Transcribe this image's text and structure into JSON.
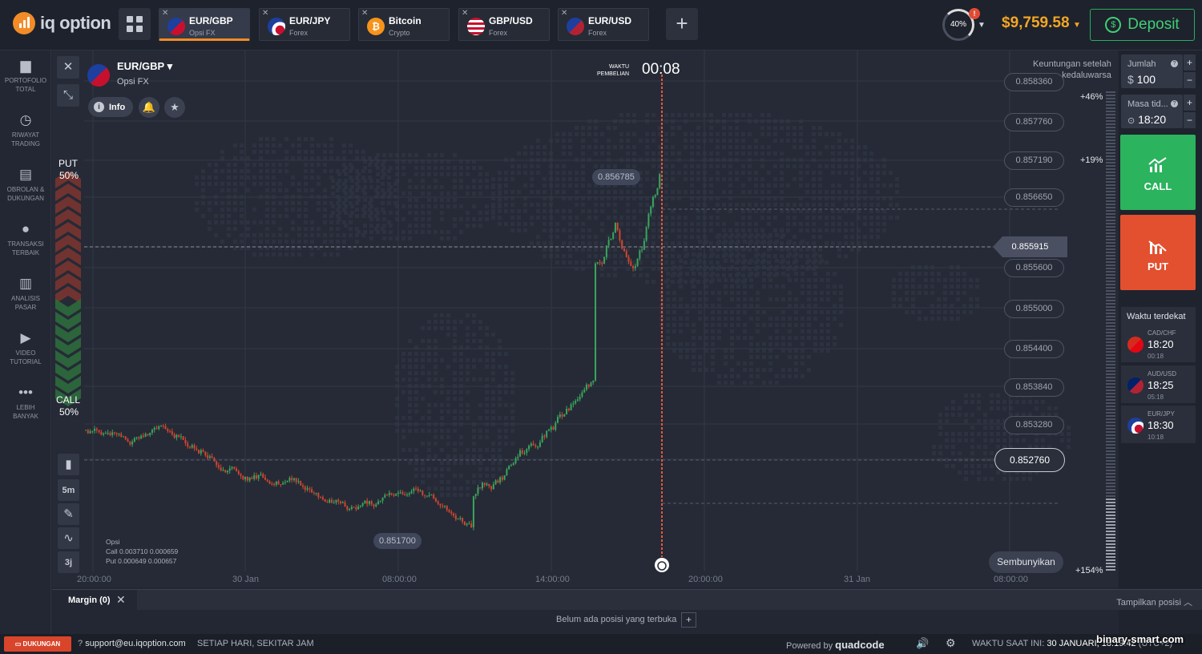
{
  "header": {
    "logo_text": "iq option",
    "tabs": [
      {
        "name": "EUR/GBP",
        "type": "Opsi FX",
        "active": true
      },
      {
        "name": "EUR/JPY",
        "type": "Forex",
        "active": false
      },
      {
        "name": "Bitcoin",
        "type": "Crypto",
        "active": false
      },
      {
        "name": "GBP/USD",
        "type": "Forex",
        "active": false
      },
      {
        "name": "EUR/USD",
        "type": "Forex",
        "active": false
      }
    ],
    "progress_label": "40%",
    "progress_value": 0.4,
    "alert_badge": "!",
    "balance": "$9,759.58",
    "deposit_label": "Deposit"
  },
  "sidebar": {
    "items": [
      {
        "label1": "PORTOFOLIO",
        "label2": "TOTAL",
        "icon": "briefcase-icon"
      },
      {
        "label1": "RIWAYAT",
        "label2": "TRADING",
        "icon": "clock-icon"
      },
      {
        "label1": "OBROLAN &",
        "label2": "DUKUNGAN",
        "icon": "chat-icon"
      },
      {
        "label1": "TRANSAKSI",
        "label2": "TERBAIK",
        "icon": "trophy-icon"
      },
      {
        "label1": "ANALISIS",
        "label2": "PASAR",
        "icon": "analysis-icon"
      },
      {
        "label1": "VIDEO",
        "label2": "TUTORIAL",
        "icon": "play-icon"
      },
      {
        "label1": "LEBIH",
        "label2": "BANYAK",
        "icon": "more-icon"
      }
    ]
  },
  "asset": {
    "name": "EUR/GBP",
    "sub": "Opsi FX",
    "info_label": "Info"
  },
  "purchase": {
    "label_line1": "WAKTU",
    "label_line2": "PEMBELIAN",
    "time": "00:08"
  },
  "sentiment": {
    "put_label": "PUT",
    "put_pct": "50%",
    "call_label": "CALL",
    "call_pct": "50%"
  },
  "toolbar": {
    "timeframe": "5m",
    "period": "3j"
  },
  "opsi": {
    "title": "Opsi",
    "call_line": "Call 0.003710  0.000659",
    "put_line": "Put  0.000649  0.000657"
  },
  "payout": {
    "line1": "Keuntungan setelah",
    "line2": "kedaluwarsa",
    "pct_top": "+46%",
    "pct_mid": "+19%",
    "pct_bottom": "+154%"
  },
  "price_axis": [
    "0.858360",
    "0.857760",
    "0.857190",
    "0.856650",
    "0.855600",
    "0.855000",
    "0.854400",
    "0.853840",
    "0.853280"
  ],
  "current_price": "0.855915",
  "selected_price": "0.852760",
  "high_label": "0.856785",
  "low_label": "0.851700",
  "time_axis": [
    "20:00:00",
    "30 Jan",
    "08:00:00",
    "14:00:00",
    "20:00:00",
    "31 Jan",
    "08:00:00"
  ],
  "hide_label": "Sembunyikan",
  "trade": {
    "amount_label": "Jumlah",
    "amount_value": "100",
    "currency_symbol": "$",
    "expiry_label": "Masa tid...",
    "expiry_value": "18:20",
    "call_label": "CALL",
    "put_label": "PUT",
    "call_color": "#2bb35d",
    "put_color": "#e2502f"
  },
  "nearest": {
    "title": "Waktu terdekat",
    "items": [
      {
        "pair": "CAD/CHF",
        "time": "18:20",
        "countdown": "00:18"
      },
      {
        "pair": "AUD/USD",
        "time": "18:25",
        "countdown": "05:18"
      },
      {
        "pair": "EUR/JPY",
        "time": "18:30",
        "countdown": "10:18"
      }
    ]
  },
  "positions": {
    "margin_tab": "Margin (0)",
    "show_positions": "Tampilkan posisi",
    "empty_text": "Belum ada posisi yang terbuka"
  },
  "status": {
    "support_btn": "DUKUNGAN",
    "email": "support@eu.iqoption.com",
    "hours": "SETIAP HARI, SEKITAR JAM",
    "powered_by": "Powered by",
    "powered_brand": "quadcode",
    "server_time_label": "WAKTU SAAT INI:",
    "server_time": "30 JANUARI, 18:19:42",
    "timezone": "(UTC+2)"
  },
  "watermark": "binary-smart.com",
  "chart_data": {
    "type": "candlestick",
    "ylim": [
      0.8512,
      0.8587
    ],
    "current": 0.855915,
    "high": 0.856785,
    "low": 0.8517,
    "x_ticks": [
      "20:00:00",
      "30 Jan",
      "08:00:00",
      "14:00:00",
      "20:00:00",
      "31 Jan",
      "08:00:00"
    ]
  }
}
